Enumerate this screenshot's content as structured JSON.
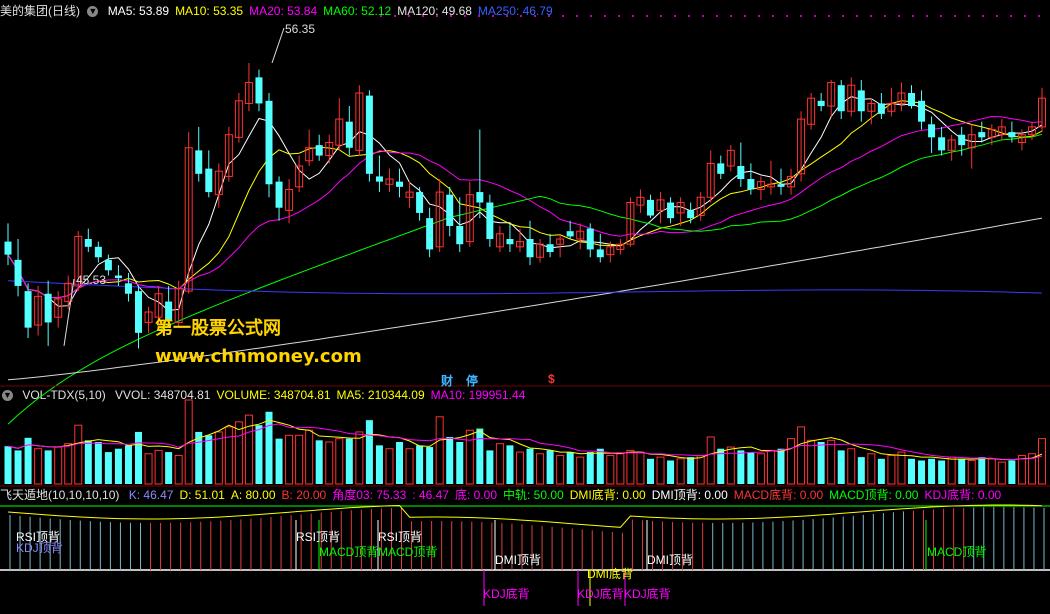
{
  "header_main": {
    "title": "美的集团(日线)",
    "ma": [
      {
        "label": "MA5: 53.89",
        "color": "#ffffff"
      },
      {
        "label": "MA10: 53.35",
        "color": "#ffff00"
      },
      {
        "label": "MA20: 53.84",
        "color": "#ff00ff"
      },
      {
        "label": "MA60: 52.12",
        "color": "#00ff00"
      },
      {
        "label": "MA120: 49.68",
        "color": "#e0e0e0"
      },
      {
        "label": "MA250: 46.79",
        "color": "#3a5fff"
      }
    ]
  },
  "header_vol": {
    "title": "VOL-TDX(5,10)",
    "items": [
      {
        "label": "VVOL: 348704.81",
        "color": "#e0e0e0"
      },
      {
        "label": "VOLUME: 348704.81",
        "color": "#ffff00"
      },
      {
        "label": "MA5: 210344.09",
        "color": "#ffff00"
      },
      {
        "label": "MA10: 199951.44",
        "color": "#ff00ff"
      }
    ]
  },
  "header_ind": {
    "title": "飞天遁地(10,10,10,10)",
    "items": [
      {
        "label": "K: 46.47",
        "color": "#8a8aff"
      },
      {
        "label": "D: 51.01",
        "color": "#ffff00"
      },
      {
        "label": "A: 80.00",
        "color": "#ffff00"
      },
      {
        "label": "B: 20.00",
        "color": "#ff3333"
      },
      {
        "label": "角度03: 75.33",
        "color": "#ff00ff"
      },
      {
        "label": ": 46.47",
        "color": "#ff00ff"
      },
      {
        "label": "底: 0.00",
        "color": "#ff00ff"
      },
      {
        "label": "中轨: 50.00",
        "color": "#00ff00"
      },
      {
        "label": "DMI底背: 0.00",
        "color": "#ffff00"
      },
      {
        "label": "DMI顶背: 0.00",
        "color": "#ffffff"
      },
      {
        "label": "MACD底背: 0.00",
        "color": "#ff3333"
      },
      {
        "label": "MACD顶背: 0.00",
        "color": "#00ff00"
      },
      {
        "label": "KDJ底背: 0.00",
        "color": "#ff00ff"
      }
    ]
  },
  "watermark": {
    "line1": "第一股票公式网",
    "line2": "www.chnmoney.com"
  },
  "markers": {
    "cai": "财",
    "ting": "停",
    "dollar": "$"
  },
  "annotations": {
    "high": "56.35",
    "low": "45.53"
  },
  "signals": {
    "rsi1": "RSI顶背",
    "kdj1": "KDJ顶背",
    "rsi2": "RSI顶背",
    "rsi3": "RSI顶背",
    "macd1": "MACD顶背",
    "macd2": "MACD顶背",
    "macd3": "MACD顶背",
    "dmi1": "DMI顶背",
    "dmi2": "DMI顶背",
    "dmi_bottom": "DMI底背",
    "kdjb1": "KDJ底背",
    "kdjb2": "KDJ底背",
    "kdjb3": "KDJ底背"
  },
  "chart_data": {
    "type": "candlestick",
    "price_range": [
      44,
      58
    ],
    "candles": [
      {
        "o": 49.5,
        "h": 50.2,
        "l": 48.6,
        "c": 49.0
      },
      {
        "o": 48.8,
        "h": 49.6,
        "l": 47.4,
        "c": 47.8
      },
      {
        "o": 47.6,
        "h": 47.9,
        "l": 45.8,
        "c": 46.2
      },
      {
        "o": 46.3,
        "h": 47.8,
        "l": 45.9,
        "c": 47.4
      },
      {
        "o": 47.5,
        "h": 48.0,
        "l": 45.5,
        "c": 46.4
      },
      {
        "o": 46.6,
        "h": 47.6,
        "l": 46.2,
        "c": 47.3
      },
      {
        "o": 47.2,
        "h": 48.2,
        "l": 46.9,
        "c": 47.9
      },
      {
        "o": 47.8,
        "h": 49.9,
        "l": 47.6,
        "c": 49.7
      },
      {
        "o": 49.6,
        "h": 50.0,
        "l": 49.1,
        "c": 49.3
      },
      {
        "o": 49.3,
        "h": 49.5,
        "l": 48.7,
        "c": 48.9
      },
      {
        "o": 48.8,
        "h": 49.0,
        "l": 48.2,
        "c": 48.4
      },
      {
        "o": 48.2,
        "h": 48.6,
        "l": 47.8,
        "c": 48.1
      },
      {
        "o": 47.9,
        "h": 48.3,
        "l": 47.2,
        "c": 47.5
      },
      {
        "o": 47.6,
        "h": 47.8,
        "l": 45.4,
        "c": 46.0
      },
      {
        "o": 46.4,
        "h": 47.0,
        "l": 46.0,
        "c": 46.8
      },
      {
        "o": 46.6,
        "h": 47.8,
        "l": 46.3,
        "c": 47.5
      },
      {
        "o": 47.2,
        "h": 47.8,
        "l": 46.2,
        "c": 46.5
      },
      {
        "o": 46.4,
        "h": 48.0,
        "l": 46.2,
        "c": 47.7
      },
      {
        "o": 47.6,
        "h": 53.7,
        "l": 47.5,
        "c": 53.1
      },
      {
        "o": 53.0,
        "h": 53.9,
        "l": 51.8,
        "c": 52.1
      },
      {
        "o": 52.3,
        "h": 53.0,
        "l": 51.2,
        "c": 51.4
      },
      {
        "o": 51.3,
        "h": 52.5,
        "l": 50.8,
        "c": 52.2
      },
      {
        "o": 52.0,
        "h": 53.9,
        "l": 51.8,
        "c": 53.6
      },
      {
        "o": 53.5,
        "h": 55.2,
        "l": 53.3,
        "c": 54.9
      },
      {
        "o": 54.8,
        "h": 56.35,
        "l": 54.5,
        "c": 55.6
      },
      {
        "o": 55.8,
        "h": 56.1,
        "l": 54.5,
        "c": 54.8
      },
      {
        "o": 54.9,
        "h": 55.2,
        "l": 51.2,
        "c": 51.7
      },
      {
        "o": 51.8,
        "h": 52.0,
        "l": 50.3,
        "c": 50.8
      },
      {
        "o": 50.7,
        "h": 51.9,
        "l": 50.2,
        "c": 51.5
      },
      {
        "o": 51.6,
        "h": 52.8,
        "l": 51.4,
        "c": 52.4
      },
      {
        "o": 52.6,
        "h": 53.8,
        "l": 52.4,
        "c": 53.1
      },
      {
        "o": 53.2,
        "h": 53.6,
        "l": 52.6,
        "c": 52.8
      },
      {
        "o": 52.8,
        "h": 53.6,
        "l": 52.5,
        "c": 53.3
      },
      {
        "o": 53.2,
        "h": 55.0,
        "l": 53.0,
        "c": 54.2
      },
      {
        "o": 54.1,
        "h": 54.7,
        "l": 52.8,
        "c": 53.1
      },
      {
        "o": 53.0,
        "h": 55.5,
        "l": 52.8,
        "c": 55.2
      },
      {
        "o": 55.1,
        "h": 55.3,
        "l": 51.8,
        "c": 52.1
      },
      {
        "o": 52.0,
        "h": 52.8,
        "l": 51.4,
        "c": 51.8
      },
      {
        "o": 51.7,
        "h": 52.3,
        "l": 51.4,
        "c": 51.9
      },
      {
        "o": 51.8,
        "h": 52.3,
        "l": 51.2,
        "c": 51.6
      },
      {
        "o": 51.2,
        "h": 51.8,
        "l": 50.8,
        "c": 51.4
      },
      {
        "o": 51.4,
        "h": 51.6,
        "l": 50.3,
        "c": 50.6
      },
      {
        "o": 50.4,
        "h": 50.8,
        "l": 48.9,
        "c": 49.2
      },
      {
        "o": 49.3,
        "h": 51.9,
        "l": 49.1,
        "c": 51.4
      },
      {
        "o": 51.3,
        "h": 51.6,
        "l": 49.7,
        "c": 50.1
      },
      {
        "o": 50.1,
        "h": 51.2,
        "l": 49.1,
        "c": 49.4
      },
      {
        "o": 49.5,
        "h": 51.8,
        "l": 49.3,
        "c": 51.3
      },
      {
        "o": 51.4,
        "h": 53.8,
        "l": 50.4,
        "c": 51.0
      },
      {
        "o": 51.0,
        "h": 51.3,
        "l": 49.3,
        "c": 49.6
      },
      {
        "o": 49.3,
        "h": 50.1,
        "l": 49.1,
        "c": 49.8
      },
      {
        "o": 49.6,
        "h": 50.2,
        "l": 49.1,
        "c": 49.4
      },
      {
        "o": 49.3,
        "h": 50.0,
        "l": 49.1,
        "c": 49.5
      },
      {
        "o": 49.6,
        "h": 50.3,
        "l": 48.6,
        "c": 48.9
      },
      {
        "o": 48.9,
        "h": 49.6,
        "l": 48.7,
        "c": 49.4
      },
      {
        "o": 49.4,
        "h": 49.8,
        "l": 48.9,
        "c": 49.1
      },
      {
        "o": 49.4,
        "h": 49.8,
        "l": 48.9,
        "c": 49.6
      },
      {
        "o": 49.9,
        "h": 50.3,
        "l": 49.6,
        "c": 49.7
      },
      {
        "o": 49.6,
        "h": 50.2,
        "l": 49.2,
        "c": 49.9
      },
      {
        "o": 50.0,
        "h": 50.2,
        "l": 48.9,
        "c": 49.2
      },
      {
        "o": 49.2,
        "h": 49.8,
        "l": 48.7,
        "c": 48.9
      },
      {
        "o": 49.0,
        "h": 49.5,
        "l": 48.7,
        "c": 49.3
      },
      {
        "o": 49.2,
        "h": 49.6,
        "l": 49.0,
        "c": 49.4
      },
      {
        "o": 49.4,
        "h": 51.2,
        "l": 49.3,
        "c": 51.0
      },
      {
        "o": 50.9,
        "h": 51.5,
        "l": 50.6,
        "c": 51.2
      },
      {
        "o": 51.1,
        "h": 51.3,
        "l": 50.4,
        "c": 50.5
      },
      {
        "o": 50.7,
        "h": 51.4,
        "l": 50.2,
        "c": 51.1
      },
      {
        "o": 51.0,
        "h": 51.2,
        "l": 50.2,
        "c": 50.4
      },
      {
        "o": 50.6,
        "h": 51.2,
        "l": 50.1,
        "c": 51.0
      },
      {
        "o": 50.7,
        "h": 51.0,
        "l": 50.2,
        "c": 50.4
      },
      {
        "o": 50.5,
        "h": 51.4,
        "l": 50.3,
        "c": 51.2
      },
      {
        "o": 51.2,
        "h": 53.0,
        "l": 51.0,
        "c": 52.5
      },
      {
        "o": 52.5,
        "h": 52.8,
        "l": 51.9,
        "c": 52.1
      },
      {
        "o": 52.4,
        "h": 53.2,
        "l": 52.2,
        "c": 53.0
      },
      {
        "o": 52.4,
        "h": 53.3,
        "l": 51.6,
        "c": 51.9
      },
      {
        "o": 51.9,
        "h": 52.5,
        "l": 51.3,
        "c": 51.5
      },
      {
        "o": 51.5,
        "h": 52.0,
        "l": 51.1,
        "c": 51.8
      },
      {
        "o": 51.6,
        "h": 52.6,
        "l": 51.3,
        "c": 51.7
      },
      {
        "o": 51.7,
        "h": 52.3,
        "l": 51.3,
        "c": 51.6
      },
      {
        "o": 51.6,
        "h": 52.3,
        "l": 51.3,
        "c": 52.0
      },
      {
        "o": 52.1,
        "h": 54.5,
        "l": 51.8,
        "c": 54.2
      },
      {
        "o": 54.0,
        "h": 55.2,
        "l": 53.8,
        "c": 55.0
      },
      {
        "o": 54.9,
        "h": 55.2,
        "l": 54.5,
        "c": 54.7
      },
      {
        "o": 54.7,
        "h": 55.7,
        "l": 54.3,
        "c": 55.6
      },
      {
        "o": 55.5,
        "h": 55.7,
        "l": 54.2,
        "c": 54.5
      },
      {
        "o": 54.5,
        "h": 55.8,
        "l": 54.3,
        "c": 55.5
      },
      {
        "o": 55.3,
        "h": 55.7,
        "l": 54.1,
        "c": 54.5
      },
      {
        "o": 54.5,
        "h": 55.0,
        "l": 54.0,
        "c": 54.8
      },
      {
        "o": 54.8,
        "h": 55.2,
        "l": 54.2,
        "c": 54.4
      },
      {
        "o": 54.5,
        "h": 55.4,
        "l": 54.3,
        "c": 54.8
      },
      {
        "o": 54.8,
        "h": 55.6,
        "l": 54.5,
        "c": 55.2
      },
      {
        "o": 55.2,
        "h": 55.5,
        "l": 54.6,
        "c": 54.7
      },
      {
        "o": 54.9,
        "h": 55.3,
        "l": 53.8,
        "c": 54.1
      },
      {
        "o": 54.0,
        "h": 54.3,
        "l": 52.9,
        "c": 53.5
      },
      {
        "o": 53.5,
        "h": 53.9,
        "l": 52.8,
        "c": 53.0
      },
      {
        "o": 53.0,
        "h": 53.6,
        "l": 52.6,
        "c": 53.4
      },
      {
        "o": 53.6,
        "h": 53.9,
        "l": 52.8,
        "c": 53.2
      },
      {
        "o": 53.1,
        "h": 54.0,
        "l": 52.3,
        "c": 53.6
      },
      {
        "o": 53.7,
        "h": 54.1,
        "l": 53.3,
        "c": 53.5
      },
      {
        "o": 53.5,
        "h": 54.0,
        "l": 53.2,
        "c": 53.8
      },
      {
        "o": 53.6,
        "h": 54.2,
        "l": 53.4,
        "c": 53.9
      },
      {
        "o": 53.7,
        "h": 54.1,
        "l": 53.3,
        "c": 53.5
      },
      {
        "o": 53.3,
        "h": 53.8,
        "l": 53.0,
        "c": 53.6
      },
      {
        "o": 53.6,
        "h": 54.1,
        "l": 53.4,
        "c": 53.9
      },
      {
        "o": 53.9,
        "h": 55.4,
        "l": 53.7,
        "c": 55.0
      }
    ],
    "volume": [
      0.45,
      0.4,
      0.55,
      0.42,
      0.4,
      0.44,
      0.48,
      0.7,
      0.52,
      0.5,
      0.38,
      0.42,
      0.46,
      0.62,
      0.36,
      0.4,
      0.38,
      0.34,
      1.0,
      0.62,
      0.58,
      0.62,
      0.68,
      0.74,
      0.82,
      0.7,
      0.86,
      0.54,
      0.58,
      0.58,
      0.64,
      0.52,
      0.5,
      0.54,
      0.54,
      0.62,
      0.76,
      0.46,
      0.42,
      0.5,
      0.42,
      0.46,
      0.44,
      0.8,
      0.56,
      0.5,
      0.64,
      0.66,
      0.4,
      0.48,
      0.46,
      0.38,
      0.42,
      0.36,
      0.4,
      0.34,
      0.38,
      0.32,
      0.38,
      0.42,
      0.34,
      0.36,
      0.4,
      0.38,
      0.3,
      0.32,
      0.28,
      0.3,
      0.32,
      0.34,
      0.56,
      0.42,
      0.44,
      0.4,
      0.38,
      0.36,
      0.4,
      0.42,
      0.54,
      0.68,
      0.52,
      0.5,
      0.52,
      0.4,
      0.42,
      0.32,
      0.36,
      0.3,
      0.34,
      0.38,
      0.3,
      0.28,
      0.3,
      0.28,
      0.32,
      0.3,
      0.28,
      0.32,
      0.3,
      0.26,
      0.28,
      0.34,
      0.36,
      0.54
    ]
  }
}
